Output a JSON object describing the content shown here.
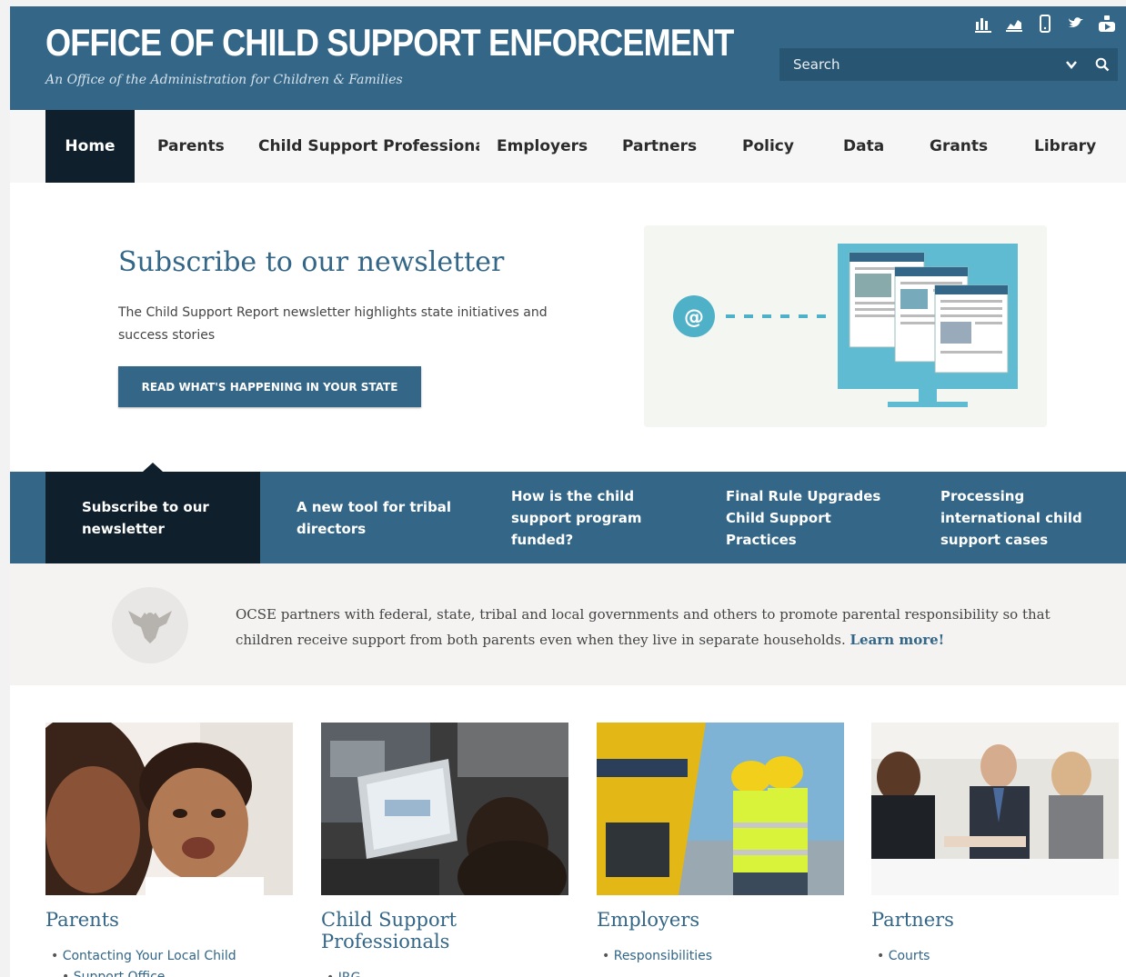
{
  "header": {
    "title": "OFFICE OF CHILD SUPPORT ENFORCEMENT",
    "subtitle": "An Office of the Administration for Children & Families",
    "icons": [
      "blog-icon",
      "blog-icon",
      "mobile-icon",
      "twitter-icon",
      "youtube-icon"
    ],
    "search": {
      "placeholder": "Search"
    }
  },
  "nav": {
    "items": [
      {
        "label": "Home"
      },
      {
        "label": "Parents"
      },
      {
        "label": "Child Support Professionals"
      },
      {
        "label": "Employers"
      },
      {
        "label": "Partners"
      },
      {
        "label": "Policy"
      },
      {
        "label": "Data"
      },
      {
        "label": "Grants"
      },
      {
        "label": "Library"
      }
    ]
  },
  "hero": {
    "title": "Subscribe to our newsletter",
    "description": "The Child Support Report newsletter highlights state initiatives and success stories",
    "cta": "READ WHAT'S HAPPENING IN YOUR STATE"
  },
  "features": [
    {
      "label": "Subscribe to our newsletter"
    },
    {
      "label": "A new tool for tribal directors"
    },
    {
      "label": "How is the child support program funded?"
    },
    {
      "label": "Final Rule Upgrades Child Support Practices"
    },
    {
      "label": "Processing international child support cases"
    }
  ],
  "mission": {
    "text": "OCSE partners with federal, state, tribal and local governments and others to promote parental responsibility so that children receive support from both parents even when they live in separate households.",
    "link": "Learn more!"
  },
  "cards": [
    {
      "title": "Parents",
      "links": [
        "Contacting Your Local Child",
        "Support Office"
      ]
    },
    {
      "title": "Child Support Professionals",
      "links": [
        "IRG"
      ]
    },
    {
      "title": "Employers",
      "links": [
        "Responsibilities"
      ]
    },
    {
      "title": "Partners",
      "links": [
        "Courts"
      ]
    }
  ],
  "colors": {
    "brand": "#336687",
    "dark": "#0f1f2b",
    "search": "#285572"
  }
}
